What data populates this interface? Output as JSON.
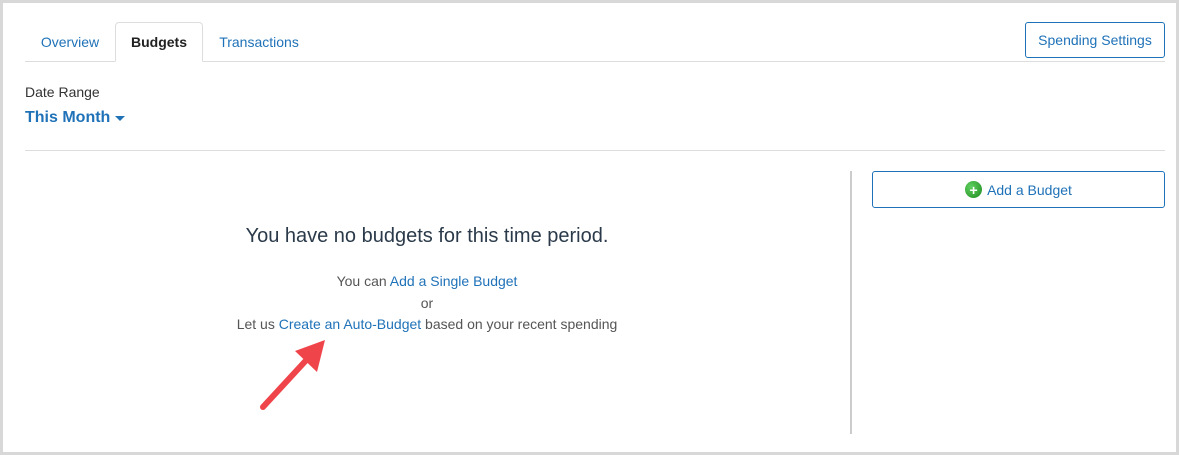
{
  "tabs": [
    {
      "label": "Overview",
      "active": false
    },
    {
      "label": "Budgets",
      "active": true
    },
    {
      "label": "Transactions",
      "active": false
    }
  ],
  "spending_settings_label": "Spending Settings",
  "date_range": {
    "label": "Date Range",
    "value": "This Month"
  },
  "empty_state": {
    "title": "You have no budgets for this time period.",
    "line1_prefix": "You can ",
    "line1_link": "Add a Single Budget",
    "line2": "or",
    "line3_prefix": "Let us ",
    "line3_link": "Create an Auto-Budget",
    "line3_suffix": " based on your recent spending"
  },
  "add_budget_label": "Add a Budget",
  "icons": {
    "add": "plus-circle-icon",
    "dropdown": "caret-down-icon",
    "annotation": "red-arrow-icon"
  },
  "colors": {
    "link": "#1f72b8",
    "annotation_arrow": "#f0444b",
    "add_icon": "#2ea02e"
  }
}
